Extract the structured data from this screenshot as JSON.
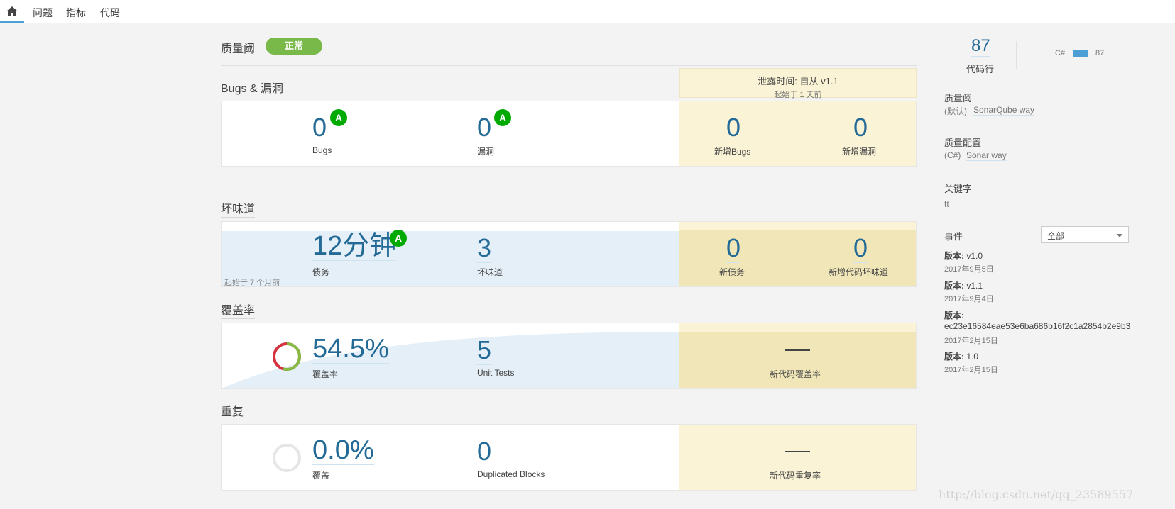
{
  "nav": {
    "home_icon": "home-icon",
    "tabs": [
      "问题",
      "指标",
      "代码"
    ]
  },
  "quality_gate": {
    "title": "质量阈",
    "status": "正常",
    "status_color": "#79b94a"
  },
  "leak": {
    "title": "泄露时间: 自从 v1.1",
    "since": "起始于 1 天前",
    "bg_color": "#fbf3d5"
  },
  "bugs": {
    "title": "Bugs & 漏洞",
    "bugs_value": "0",
    "bugs_label": "Bugs",
    "bugs_rating": "A",
    "vuln_value": "0",
    "vuln_label": "漏洞",
    "vuln_rating": "A",
    "new_bugs_value": "0",
    "new_bugs_label": "新增Bugs",
    "new_vuln_value": "0",
    "new_vuln_label": "新增漏洞"
  },
  "smells": {
    "title": "坏味道",
    "debt_value": "12分钟",
    "debt_label": "债务",
    "debt_rating": "A",
    "smells_value": "3",
    "smells_label": "坏味道",
    "since": "起始于 7 个月前",
    "new_debt_value": "0",
    "new_debt_label": "新债务",
    "new_smells_value": "0",
    "new_smells_label": "新增代码坏味道"
  },
  "coverage": {
    "title": "覆盖率",
    "value": "54.5%",
    "fraction": 0.545,
    "label": "覆盖率",
    "tests_value": "5",
    "tests_label": "Unit Tests",
    "new_label": "新代码覆盖率"
  },
  "duplication": {
    "title": "重复",
    "value": "0.0%",
    "fraction": 0.0,
    "label": "覆盖",
    "blocks_value": "0",
    "blocks_label": "Duplicated Blocks",
    "new_label": "新代码重复率"
  },
  "sidebar": {
    "lines_value": "87",
    "lines_label": "代码行",
    "lang_name": "C#",
    "lang_value": "87",
    "lang_color": "#4b9fd5",
    "qg_title": "质量阈",
    "qg_prefix": "(默认)",
    "qg_link": "SonarQube way",
    "qp_title": "质量配置",
    "qp_prefix": "(C#)",
    "qp_link": "Sonar way",
    "keywords_title": "关键字",
    "keywords_value": "tt",
    "events_title": "事件",
    "events_filter": "全部",
    "events": [
      {
        "label": "版本:",
        "name": "v1.0",
        "date": "2017年9月5日"
      },
      {
        "label": "版本:",
        "name": "v1.1",
        "date": "2017年9月4日"
      },
      {
        "label": "版本:",
        "name": "ec23e16584eae53e6ba686b16f2c1a2854b2e9b3",
        "date": "2017年2月15日"
      },
      {
        "label": "版本:",
        "name": "1.0",
        "date": "2017年2月15日"
      }
    ]
  },
  "watermark": "http://blog.csdn.net/qq_23589557"
}
